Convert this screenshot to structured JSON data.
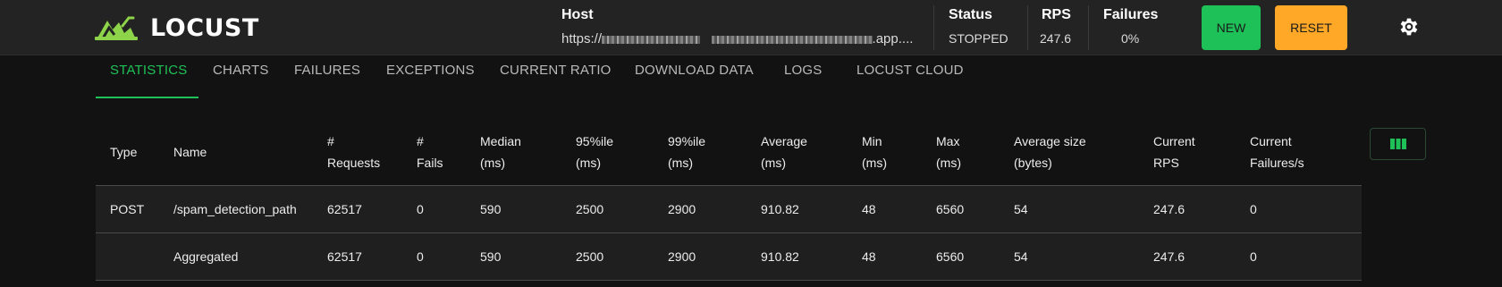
{
  "app": {
    "name": "LOCUST",
    "accent": "#1ec157"
  },
  "header": {
    "host_label": "Host",
    "host_prefix": "https://",
    "host_suffix": ".app....",
    "status_label": "Status",
    "status_value": "STOPPED",
    "rps_label": "RPS",
    "rps_value": "247.6",
    "failures_label": "Failures",
    "failures_value": "0%",
    "new_label": "NEW",
    "reset_label": "RESET",
    "settings_icon": "gear-icon"
  },
  "tabs": [
    {
      "label": "STATISTICS",
      "active": true
    },
    {
      "label": "CHARTS"
    },
    {
      "label": "FAILURES"
    },
    {
      "label": "EXCEPTIONS"
    },
    {
      "label": "CURRENT RATIO"
    },
    {
      "label": "DOWNLOAD DATA"
    },
    {
      "label": "LOGS"
    },
    {
      "label": "LOCUST CLOUD"
    }
  ],
  "table": {
    "headers": [
      [
        "Type"
      ],
      [
        "Name"
      ],
      [
        "#",
        "Requests"
      ],
      [
        "#",
        "Fails"
      ],
      [
        "Median",
        "(ms)"
      ],
      [
        "95%ile",
        "(ms)"
      ],
      [
        "99%ile",
        "(ms)"
      ],
      [
        "Average",
        "(ms)"
      ],
      [
        "Min",
        "(ms)"
      ],
      [
        "Max",
        "(ms)"
      ],
      [
        "Average size",
        "(bytes)"
      ],
      [
        "Current",
        "RPS"
      ],
      [
        "Current",
        "Failures/s"
      ]
    ],
    "rows": [
      [
        "POST",
        "/spam_detection_path",
        "62517",
        "0",
        "590",
        "2500",
        "2900",
        "910.82",
        "48",
        "6560",
        "54",
        "247.6",
        "0"
      ],
      [
        "",
        "Aggregated",
        "62517",
        "0",
        "590",
        "2500",
        "2900",
        "910.82",
        "48",
        "6560",
        "54",
        "247.6",
        "0"
      ]
    ],
    "column_toggle_icon": "columns-icon"
  }
}
